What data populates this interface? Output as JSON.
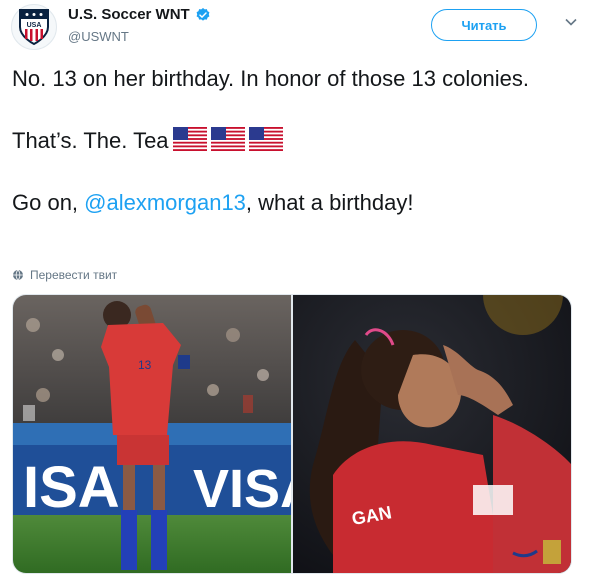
{
  "account": {
    "display_name": "U.S. Soccer WNT",
    "handle": "@USWNT",
    "follow_label": "Читать",
    "avatar_text": "USA"
  },
  "tweet": {
    "line1": "No. 13 on her birthday. In honor of those 13 colonies.",
    "line2": "That’s. The. Tea",
    "line3_pre": "Go on, ",
    "mention": "@alexmorgan13",
    "line3_post": ", what a birthday!",
    "flags_count": 3,
    "translate_label": "Перевести твит"
  },
  "media": {
    "photos": [
      {
        "name": "photo-left",
        "ad_text": "ISA",
        "ad_text2": "VISA",
        "jersey_number": "13"
      },
      {
        "name": "photo-right",
        "jersey_text": "GAN"
      }
    ]
  },
  "colors": {
    "accent": "#1da1f2",
    "text": "#14171a",
    "secondary": "#657786",
    "border": "#e1e8ed"
  },
  "icons": [
    "verified-badge-icon",
    "chevron-down-icon",
    "globe-icon",
    "us-flag-icon"
  ]
}
